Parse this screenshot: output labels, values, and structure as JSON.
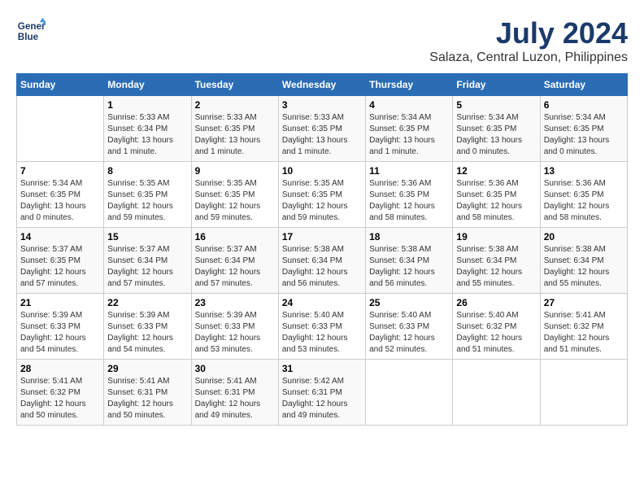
{
  "logo": {
    "line1": "General",
    "line2": "Blue"
  },
  "title": "July 2024",
  "subtitle": "Salaza, Central Luzon, Philippines",
  "days_header": [
    "Sunday",
    "Monday",
    "Tuesday",
    "Wednesday",
    "Thursday",
    "Friday",
    "Saturday"
  ],
  "weeks": [
    [
      {
        "day": "",
        "sunrise": "",
        "sunset": "",
        "daylight": ""
      },
      {
        "day": "1",
        "sunrise": "Sunrise: 5:33 AM",
        "sunset": "Sunset: 6:34 PM",
        "daylight": "Daylight: 13 hours and 1 minute."
      },
      {
        "day": "2",
        "sunrise": "Sunrise: 5:33 AM",
        "sunset": "Sunset: 6:35 PM",
        "daylight": "Daylight: 13 hours and 1 minute."
      },
      {
        "day": "3",
        "sunrise": "Sunrise: 5:33 AM",
        "sunset": "Sunset: 6:35 PM",
        "daylight": "Daylight: 13 hours and 1 minute."
      },
      {
        "day": "4",
        "sunrise": "Sunrise: 5:34 AM",
        "sunset": "Sunset: 6:35 PM",
        "daylight": "Daylight: 13 hours and 1 minute."
      },
      {
        "day": "5",
        "sunrise": "Sunrise: 5:34 AM",
        "sunset": "Sunset: 6:35 PM",
        "daylight": "Daylight: 13 hours and 0 minutes."
      },
      {
        "day": "6",
        "sunrise": "Sunrise: 5:34 AM",
        "sunset": "Sunset: 6:35 PM",
        "daylight": "Daylight: 13 hours and 0 minutes."
      }
    ],
    [
      {
        "day": "7",
        "sunrise": "Sunrise: 5:34 AM",
        "sunset": "Sunset: 6:35 PM",
        "daylight": "Daylight: 13 hours and 0 minutes."
      },
      {
        "day": "8",
        "sunrise": "Sunrise: 5:35 AM",
        "sunset": "Sunset: 6:35 PM",
        "daylight": "Daylight: 12 hours and 59 minutes."
      },
      {
        "day": "9",
        "sunrise": "Sunrise: 5:35 AM",
        "sunset": "Sunset: 6:35 PM",
        "daylight": "Daylight: 12 hours and 59 minutes."
      },
      {
        "day": "10",
        "sunrise": "Sunrise: 5:35 AM",
        "sunset": "Sunset: 6:35 PM",
        "daylight": "Daylight: 12 hours and 59 minutes."
      },
      {
        "day": "11",
        "sunrise": "Sunrise: 5:36 AM",
        "sunset": "Sunset: 6:35 PM",
        "daylight": "Daylight: 12 hours and 58 minutes."
      },
      {
        "day": "12",
        "sunrise": "Sunrise: 5:36 AM",
        "sunset": "Sunset: 6:35 PM",
        "daylight": "Daylight: 12 hours and 58 minutes."
      },
      {
        "day": "13",
        "sunrise": "Sunrise: 5:36 AM",
        "sunset": "Sunset: 6:35 PM",
        "daylight": "Daylight: 12 hours and 58 minutes."
      }
    ],
    [
      {
        "day": "14",
        "sunrise": "Sunrise: 5:37 AM",
        "sunset": "Sunset: 6:35 PM",
        "daylight": "Daylight: 12 hours and 57 minutes."
      },
      {
        "day": "15",
        "sunrise": "Sunrise: 5:37 AM",
        "sunset": "Sunset: 6:34 PM",
        "daylight": "Daylight: 12 hours and 57 minutes."
      },
      {
        "day": "16",
        "sunrise": "Sunrise: 5:37 AM",
        "sunset": "Sunset: 6:34 PM",
        "daylight": "Daylight: 12 hours and 57 minutes."
      },
      {
        "day": "17",
        "sunrise": "Sunrise: 5:38 AM",
        "sunset": "Sunset: 6:34 PM",
        "daylight": "Daylight: 12 hours and 56 minutes."
      },
      {
        "day": "18",
        "sunrise": "Sunrise: 5:38 AM",
        "sunset": "Sunset: 6:34 PM",
        "daylight": "Daylight: 12 hours and 56 minutes."
      },
      {
        "day": "19",
        "sunrise": "Sunrise: 5:38 AM",
        "sunset": "Sunset: 6:34 PM",
        "daylight": "Daylight: 12 hours and 55 minutes."
      },
      {
        "day": "20",
        "sunrise": "Sunrise: 5:38 AM",
        "sunset": "Sunset: 6:34 PM",
        "daylight": "Daylight: 12 hours and 55 minutes."
      }
    ],
    [
      {
        "day": "21",
        "sunrise": "Sunrise: 5:39 AM",
        "sunset": "Sunset: 6:33 PM",
        "daylight": "Daylight: 12 hours and 54 minutes."
      },
      {
        "day": "22",
        "sunrise": "Sunrise: 5:39 AM",
        "sunset": "Sunset: 6:33 PM",
        "daylight": "Daylight: 12 hours and 54 minutes."
      },
      {
        "day": "23",
        "sunrise": "Sunrise: 5:39 AM",
        "sunset": "Sunset: 6:33 PM",
        "daylight": "Daylight: 12 hours and 53 minutes."
      },
      {
        "day": "24",
        "sunrise": "Sunrise: 5:40 AM",
        "sunset": "Sunset: 6:33 PM",
        "daylight": "Daylight: 12 hours and 53 minutes."
      },
      {
        "day": "25",
        "sunrise": "Sunrise: 5:40 AM",
        "sunset": "Sunset: 6:33 PM",
        "daylight": "Daylight: 12 hours and 52 minutes."
      },
      {
        "day": "26",
        "sunrise": "Sunrise: 5:40 AM",
        "sunset": "Sunset: 6:32 PM",
        "daylight": "Daylight: 12 hours and 51 minutes."
      },
      {
        "day": "27",
        "sunrise": "Sunrise: 5:41 AM",
        "sunset": "Sunset: 6:32 PM",
        "daylight": "Daylight: 12 hours and 51 minutes."
      }
    ],
    [
      {
        "day": "28",
        "sunrise": "Sunrise: 5:41 AM",
        "sunset": "Sunset: 6:32 PM",
        "daylight": "Daylight: 12 hours and 50 minutes."
      },
      {
        "day": "29",
        "sunrise": "Sunrise: 5:41 AM",
        "sunset": "Sunset: 6:31 PM",
        "daylight": "Daylight: 12 hours and 50 minutes."
      },
      {
        "day": "30",
        "sunrise": "Sunrise: 5:41 AM",
        "sunset": "Sunset: 6:31 PM",
        "daylight": "Daylight: 12 hours and 49 minutes."
      },
      {
        "day": "31",
        "sunrise": "Sunrise: 5:42 AM",
        "sunset": "Sunset: 6:31 PM",
        "daylight": "Daylight: 12 hours and 49 minutes."
      },
      {
        "day": "",
        "sunrise": "",
        "sunset": "",
        "daylight": ""
      },
      {
        "day": "",
        "sunrise": "",
        "sunset": "",
        "daylight": ""
      },
      {
        "day": "",
        "sunrise": "",
        "sunset": "",
        "daylight": ""
      }
    ]
  ]
}
